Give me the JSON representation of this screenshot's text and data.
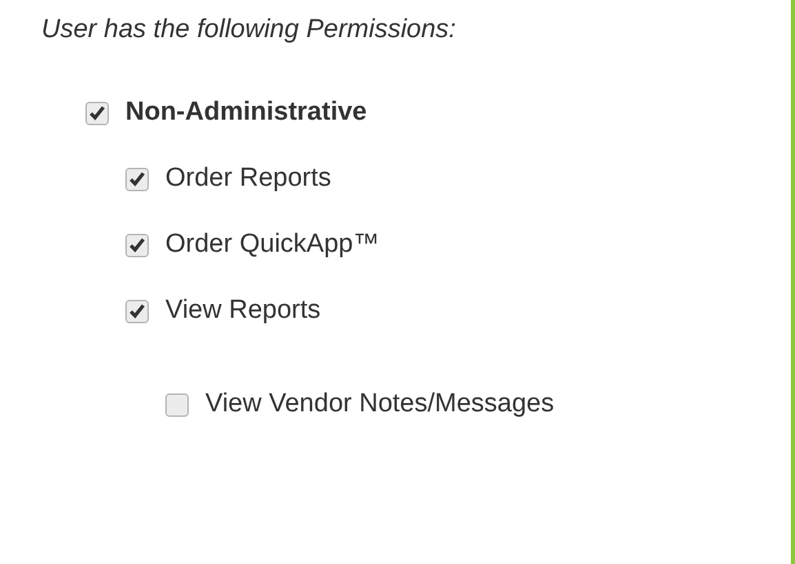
{
  "heading": "User has the following Permissions:",
  "permissions": [
    {
      "label": "Non-Administrative",
      "checked": true,
      "children": [
        {
          "label": "Order Reports",
          "checked": true
        },
        {
          "label": "Order QuickApp™",
          "checked": true
        },
        {
          "label": "View Reports",
          "checked": true,
          "children": [
            {
              "label": "View Vendor Notes/Messages",
              "checked": false
            }
          ]
        }
      ]
    }
  ]
}
